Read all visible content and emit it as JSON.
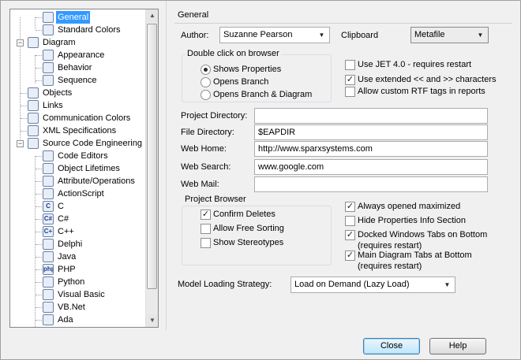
{
  "tree": {
    "items": [
      {
        "label": "General",
        "icon": "gear-icon",
        "selected": true
      },
      {
        "label": "Standard Colors",
        "icon": "palette-icon"
      },
      {
        "label": "Diagram",
        "icon": "diagram-icon"
      },
      {
        "label": "Appearance",
        "icon": "diagram-icon"
      },
      {
        "label": "Behavior",
        "icon": "diagram-icon"
      },
      {
        "label": "Sequence",
        "icon": "sequence-icon"
      },
      {
        "label": "Objects",
        "icon": "objects-icon"
      },
      {
        "label": "Links",
        "icon": "link-icon"
      },
      {
        "label": "Communication Colors",
        "icon": "palette-icon"
      },
      {
        "label": "XML Specifications",
        "icon": "xml-icon"
      },
      {
        "label": "Source Code Engineering",
        "icon": "code-icon"
      },
      {
        "label": "Code Editors",
        "icon": "editor-icon"
      },
      {
        "label": "Object Lifetimes",
        "icon": "document-icon"
      },
      {
        "label": "Attribute/Operations",
        "icon": "attribute-icon"
      },
      {
        "label": "ActionScript",
        "icon": "actionscript-icon"
      },
      {
        "label": "C",
        "icon": "c-language-icon",
        "glyph": "C"
      },
      {
        "label": "C#",
        "icon": "csharp-icon",
        "glyph": "C#"
      },
      {
        "label": "C++",
        "icon": "cpp-icon",
        "glyph": "C+"
      },
      {
        "label": "Delphi",
        "icon": "delphi-icon"
      },
      {
        "label": "Java",
        "icon": "java-icon"
      },
      {
        "label": "PHP",
        "icon": "php-icon",
        "glyph": "php"
      },
      {
        "label": "Python",
        "icon": "python-icon"
      },
      {
        "label": "Visual Basic",
        "icon": "vb-icon"
      },
      {
        "label": "VB.Net",
        "icon": "vbnet-icon"
      },
      {
        "label": "Ada",
        "icon": "ada-icon"
      }
    ]
  },
  "general": {
    "title": "General",
    "author_label": "Author:",
    "author_value": "Suzanne Pearson",
    "clipboard_label": "Clipboard",
    "clipboard_value": "Metafile",
    "double_click": {
      "title": "Double click on browser",
      "options": [
        "Shows Properties",
        "Opens Branch",
        "Opens Branch  & Diagram"
      ],
      "selected": 0
    },
    "checks_top": [
      {
        "label": "Use JET 4.0 - requires restart",
        "checked": false
      },
      {
        "label": "Use extended << and >> characters",
        "checked": true
      },
      {
        "label": "Allow custom RTF tags in reports",
        "checked": false
      }
    ],
    "fields": [
      {
        "label": "Project Directory:",
        "value": ""
      },
      {
        "label": "File Directory:",
        "value": "$EAPDIR"
      },
      {
        "label": "Web Home:",
        "value": "http://www.sparxsystems.com"
      },
      {
        "label": "Web Search:",
        "value": "www.google.com"
      },
      {
        "label": "Web Mail:",
        "value": ""
      }
    ],
    "project_browser": {
      "title": "Project Browser",
      "options": [
        {
          "label": "Confirm Deletes",
          "checked": true
        },
        {
          "label": "Allow Free Sorting",
          "checked": false
        },
        {
          "label": "Show Stereotypes",
          "checked": false
        }
      ]
    },
    "checks_right": [
      {
        "label": "Always opened maximized",
        "checked": true
      },
      {
        "label": "Hide Properties Info Section",
        "checked": false
      },
      {
        "label": "Docked Windows Tabs on Bottom",
        "sub": "(requires restart)",
        "checked": true
      },
      {
        "label": "Main Diagram Tabs at Bottom",
        "sub": "(requires restart)",
        "checked": true
      }
    ],
    "model_loading_label": "Model Loading Strategy:",
    "model_loading_value": "Load on Demand (Lazy Load)"
  },
  "buttons": {
    "close": "Close",
    "help": "Help"
  }
}
